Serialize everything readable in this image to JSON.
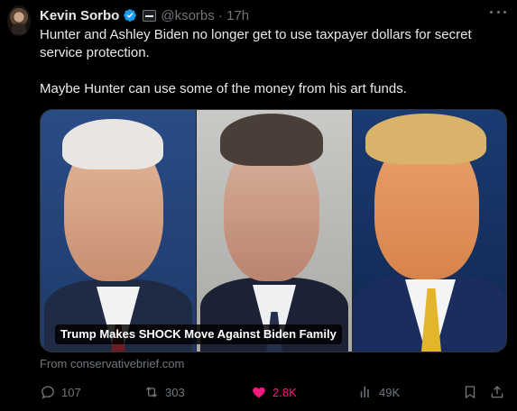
{
  "tweet": {
    "author_name": "Kevin Sorbo",
    "handle_time": "@ksorbs · 17h",
    "paragraph_1": "Hunter and Ashley Biden no longer get to use taxpayer dollars for secret service protection.",
    "paragraph_2": "Maybe Hunter can use some of the money from his art funds."
  },
  "card": {
    "caption": "Trump Makes SHOCK Move Against Biden Family",
    "source": "From conservativebrief.com"
  },
  "actions": {
    "replies": "107",
    "reposts": "303",
    "likes": "2.8K",
    "views": "49K"
  },
  "colors": {
    "background": "#000000",
    "text": "#e7e9ea",
    "muted": "#71767b",
    "verified": "#1d9bf0",
    "like": "#f91880"
  },
  "icons": [
    "verified-badge-icon",
    "affiliate-badge-icon",
    "more-icon",
    "reply-icon",
    "repost-icon",
    "like-icon",
    "views-icon",
    "bookmark-icon",
    "share-icon"
  ]
}
